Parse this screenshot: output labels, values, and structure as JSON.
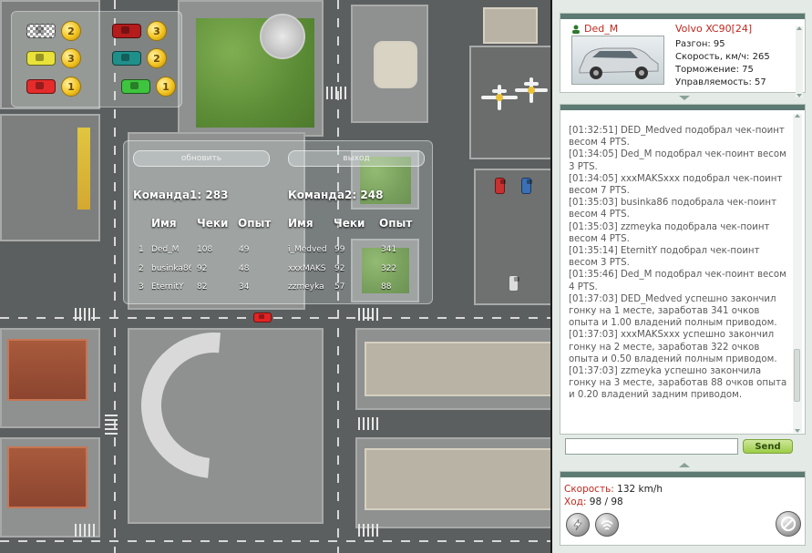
{
  "legend": [
    {
      "car_color": "#c8c8c8",
      "pattern": "checker",
      "place": "2"
    },
    {
      "car_color": "#e02020",
      "pattern": "solid",
      "place": "3"
    },
    {
      "car_color": "#e8e23a",
      "pattern": "solid",
      "place": "3"
    },
    {
      "car_color": "#1f8f8a",
      "pattern": "solid",
      "place": "2"
    },
    {
      "car_color": "#e52b2b",
      "pattern": "solid",
      "place": "1"
    },
    {
      "car_color": "#3ec43e",
      "pattern": "solid",
      "place": "1"
    }
  ],
  "results": {
    "refresh_label": "обновить",
    "exit_label": "выход",
    "team1_label": "Команда1:",
    "team1_score": "283",
    "team2_label": "Команда2:",
    "team2_score": "248",
    "headers": [
      "Имя",
      "Чеки",
      "Опыт",
      "Имя",
      "Чеки",
      "Опыт"
    ],
    "rows": [
      {
        "n": "1",
        "name1": "Ded_M",
        "cheki1": "108",
        "opyt1": "49",
        "name2": "i_Medved",
        "cheki2": "99",
        "opyt2": "341"
      },
      {
        "n": "2",
        "name1": "businka86",
        "cheki1": "92",
        "opyt1": "48",
        "name2": "xxxMAKS",
        "cheki2": "92",
        "opyt2": "322"
      },
      {
        "n": "3",
        "name1": "EternitY",
        "cheki1": "82",
        "opyt1": "34",
        "name2": "zzmeyka",
        "cheki2": "57",
        "opyt2": "88"
      }
    ]
  },
  "player": {
    "name": "Ded_M",
    "car": "Volvo XC90[24]",
    "stats": [
      "Разгон: 95",
      "Скорость, км/ч: 265",
      "Торможение: 75",
      "Управляемость: 57"
    ]
  },
  "chat": {
    "lines": [
      "[01:32:51] DED_Medved подобрал чек-поинт весом 4 PTS.",
      "[01:34:05] Ded_M подобрал чек-поинт весом 3 PTS.",
      "[01:34:05] xxxMAKSxxx подобрал чек-поинт весом 7 PTS.",
      "[01:35:03] businka86 подобрала чек-поинт весом 4 PTS.",
      "[01:35:03] zzmeyka подобрала чек-поинт весом 4 PTS.",
      "[01:35:14] EternitY подобрал чек-поинт весом 3 PTS.",
      "[01:35:46] Ded_M подобрал чек-поинт весом 4 PTS.",
      "[01:37:03] DED_Medved успешно закончил гонку на 1 месте, заработав 341 очков опыта и 1.00 владений полным приводом.",
      "[01:37:03] xxxMAKSxxx успешно закончил гонку на 2 месте, заработав 322 очков опыта и 0.50 владений полным приводом.",
      "[01:37:03] zzmeyka успешно закончила гонку на 3 месте, заработав 88 очков опыта и 0.20 владений задним приводом."
    ],
    "input_value": "",
    "send_label": "Send"
  },
  "status": {
    "speed_label": "Скорость:",
    "speed_value": "132 km/h",
    "move_label": "Ход:",
    "move_value": "98 / 98"
  },
  "colors": {
    "accent_red": "#c0281e",
    "panel_header": "#5d7a73",
    "send_green": "#9ccc48"
  }
}
